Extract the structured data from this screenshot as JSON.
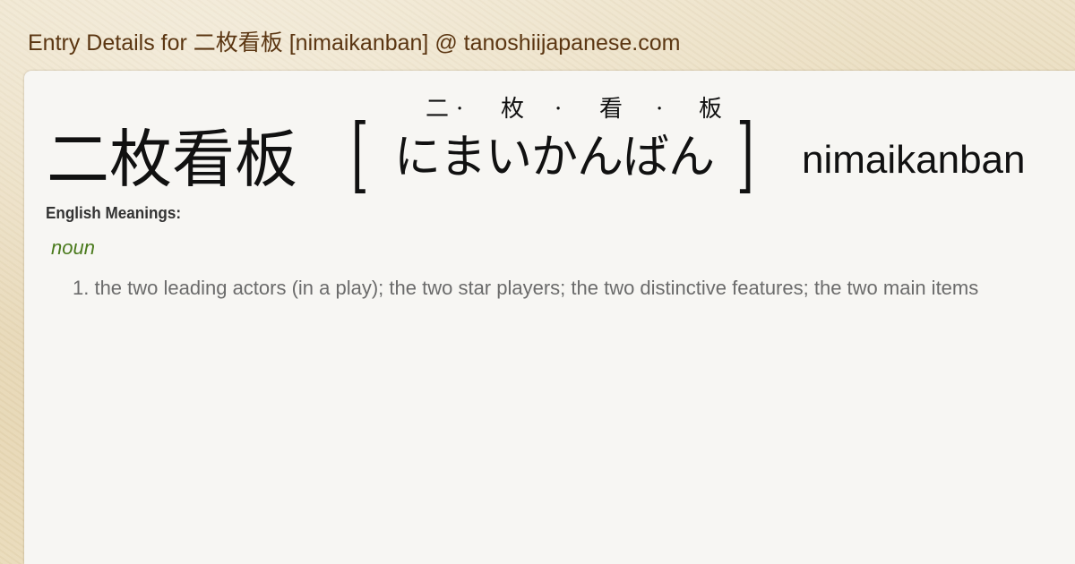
{
  "page": {
    "title": "Entry Details for 二枚看板 [nimaikanban] @ tanoshiijapanese.com"
  },
  "entry": {
    "kanji": "二枚看板",
    "bracket_open": "[",
    "bracket_close": "]",
    "furigana": [
      "二",
      "·",
      "枚",
      "·",
      "看",
      "·",
      "板"
    ],
    "reading": "にまいかんばん",
    "romaji": "nimaikanban"
  },
  "meanings": {
    "label": "English Meanings:",
    "part_of_speech": "noun",
    "items": [
      "1. the two leading actors (in a play); the two star players; the two distinctive features; the two main items"
    ]
  },
  "colors": {
    "title": "#5b3612",
    "part_of_speech": "#4a7a1c",
    "meaning_text": "#6b6b6b",
    "card_background": "#f7f6f3"
  }
}
